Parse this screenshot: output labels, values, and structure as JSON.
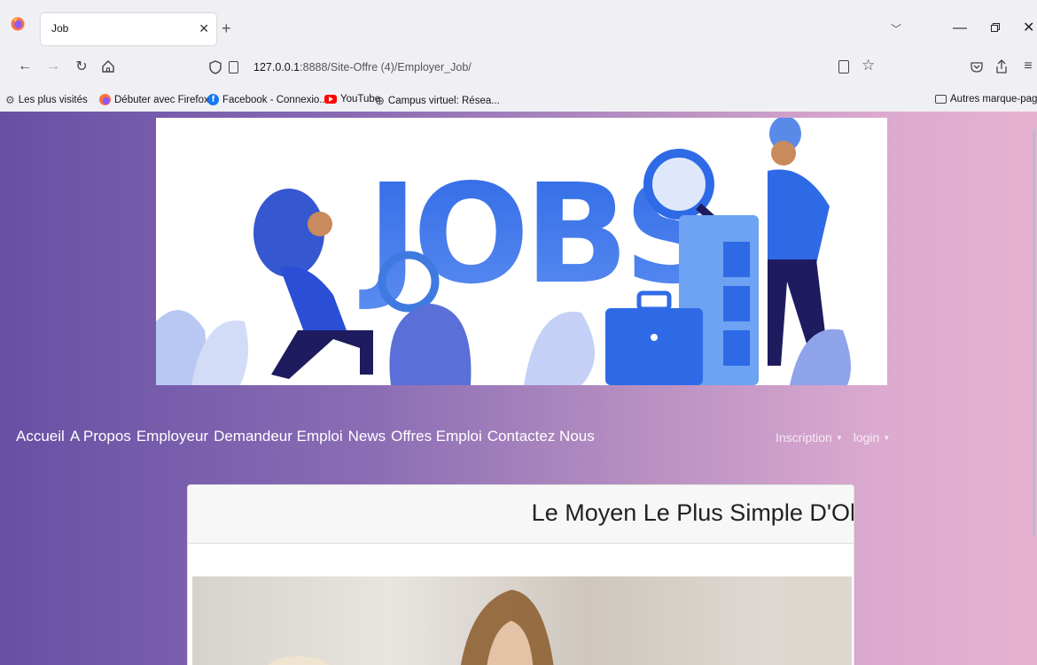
{
  "browser": {
    "tab": {
      "title": "Job"
    },
    "url": {
      "host": "127.0.0.1",
      "path": ":8888/Site-Offre (4)/Employer_Job/"
    },
    "bookmarks": [
      {
        "label": "Les plus visités",
        "icon": "gear-icon"
      },
      {
        "label": "Débuter avec Firefox",
        "icon": "firefox-icon"
      },
      {
        "label": "Facebook - Connexio...",
        "icon": "facebook-icon"
      },
      {
        "label": "YouTube",
        "icon": "youtube-icon"
      },
      {
        "label": "Campus virtuel: Résea...",
        "icon": "globe-icon"
      }
    ],
    "other_bookmarks": "Autres marque-pages"
  },
  "site": {
    "banner_word": "JOBS",
    "nav": [
      "Accueil",
      "A Propos",
      "Employeur",
      "Demandeur Emploi",
      "News",
      "Offres Emploi",
      "Contactez Nous"
    ],
    "nav_right": {
      "inscription": "Inscription",
      "login": "login"
    },
    "card": {
      "heading": "Le Moyen Le Plus Simple D'Ol"
    }
  },
  "colors": {
    "gradient_start": "#6750a4",
    "gradient_end": "#e6b2cf",
    "banner_blue": "#3f6fe0"
  }
}
